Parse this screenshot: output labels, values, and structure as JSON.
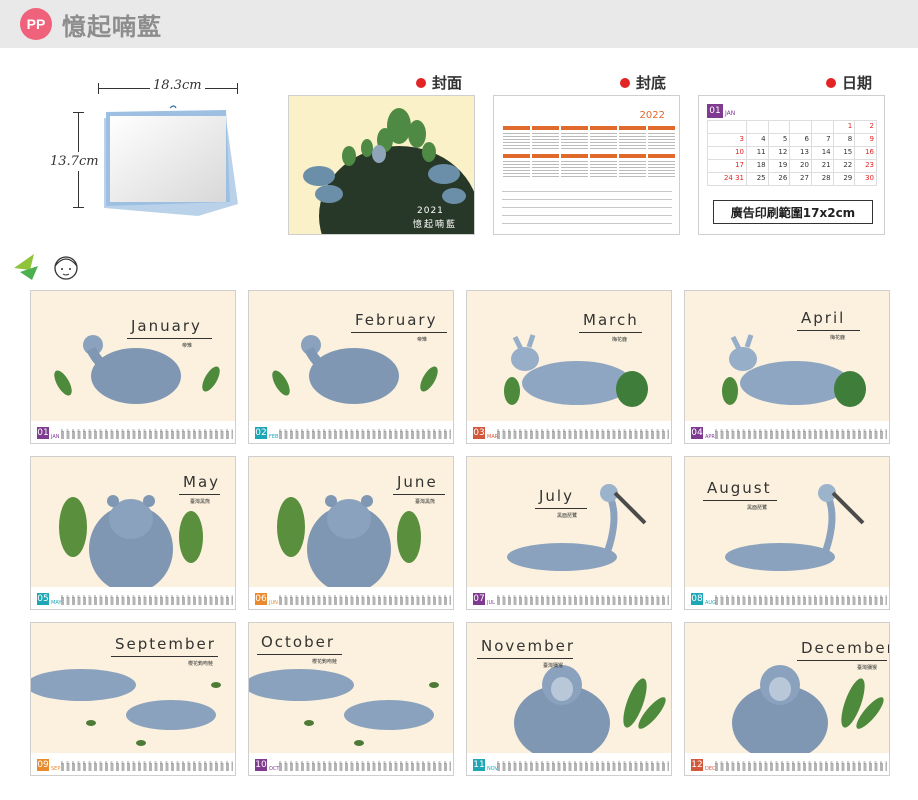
{
  "header": {
    "badge": "PP",
    "brand": "憶起喃藍"
  },
  "product": {
    "width_label": "18.3cm",
    "height_label": "13.7cm"
  },
  "previews": {
    "cover": {
      "label": "封面",
      "year": "2021",
      "title": "憶起喃藍"
    },
    "back": {
      "label": "封底",
      "year": "2022"
    },
    "date": {
      "label": "日期",
      "month_num": "01",
      "month_en": "JAN",
      "ad_text": "廣告印刷範圍17x2cm",
      "rows": [
        [
          "",
          "",
          "",
          "",
          "",
          "1",
          "2"
        ],
        [
          "3",
          "4",
          "5",
          "6",
          "7",
          "8",
          "9"
        ],
        [
          "10",
          "11",
          "12",
          "13",
          "14",
          "15",
          "16"
        ],
        [
          "17",
          "18",
          "19",
          "20",
          "21",
          "22",
          "23"
        ],
        [
          "24 31",
          "25",
          "26",
          "27",
          "28",
          "29",
          "30"
        ]
      ]
    }
  },
  "colors": {
    "accent": "#e06a2c",
    "badge": "#f0627b",
    "header_bg": "#e9e9e9",
    "card_bg": "#fbf1de"
  },
  "months": [
    {
      "en": "January",
      "ch": "帝雉",
      "num": "01",
      "abbr": "JAN",
      "color": "#7e3b8f"
    },
    {
      "en": "February",
      "ch": "帝雉",
      "num": "02",
      "abbr": "FEB",
      "color": "#1fa6b5"
    },
    {
      "en": "March",
      "ch": "梅花鹿",
      "num": "03",
      "abbr": "MAR",
      "color": "#d2573b"
    },
    {
      "en": "April",
      "ch": "梅花鹿",
      "num": "04",
      "abbr": "APR",
      "color": "#7e3b8f"
    },
    {
      "en": "May",
      "ch": "臺灣黑熊",
      "num": "05",
      "abbr": "MAY",
      "color": "#1fa6b5"
    },
    {
      "en": "June",
      "ch": "臺灣黑熊",
      "num": "06",
      "abbr": "JUN",
      "color": "#e98a2e"
    },
    {
      "en": "July",
      "ch": "黑面琵鷺",
      "num": "07",
      "abbr": "JUL",
      "color": "#7e3b8f"
    },
    {
      "en": "August",
      "ch": "黑面琵鷺",
      "num": "08",
      "abbr": "AUG",
      "color": "#1fa6b5"
    },
    {
      "en": "September",
      "ch": "櫻花鉤吻鮭",
      "num": "09",
      "abbr": "SEP",
      "color": "#e98a2e"
    },
    {
      "en": "October",
      "ch": "櫻花鉤吻鮭",
      "num": "10",
      "abbr": "OCT",
      "color": "#7e3b8f"
    },
    {
      "en": "November",
      "ch": "臺灣獼猴",
      "num": "11",
      "abbr": "NOV",
      "color": "#1fa6b5"
    },
    {
      "en": "December",
      "ch": "臺灣獼猴",
      "num": "12",
      "abbr": "DEC",
      "color": "#d2573b"
    }
  ]
}
